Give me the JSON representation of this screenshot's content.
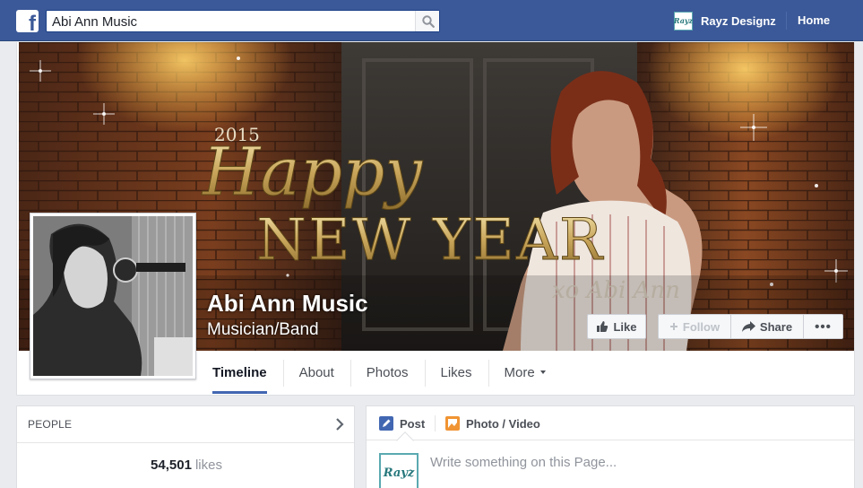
{
  "topbar": {
    "logo_letter": "f",
    "search_value": "Abi Ann Music",
    "profile_avatar_text": "Rayz",
    "profile_name": "Rayz Designz",
    "home_label": "Home"
  },
  "cover": {
    "year_text": "2015",
    "happy_text": "Happy",
    "new_year_text": "NEW YEAR",
    "signature_text": "xo Abi Ann"
  },
  "page": {
    "name": "Abi Ann Music",
    "category": "Musician/Band"
  },
  "actions": {
    "like_label": "Like",
    "follow_label": "Follow",
    "share_label": "Share",
    "more_label": "•••"
  },
  "tabs": [
    {
      "label": "Timeline",
      "active": true
    },
    {
      "label": "About"
    },
    {
      "label": "Photos"
    },
    {
      "label": "Likes"
    },
    {
      "label": "More"
    }
  ],
  "people": {
    "title": "PEOPLE",
    "likes_count": "54,501",
    "likes_label": "likes"
  },
  "composer": {
    "post_label": "Post",
    "photo_label": "Photo / Video",
    "avatar_text": "Rayz",
    "placeholder": "Write something on this Page..."
  },
  "colors": {
    "brand_blue": "#3b5998",
    "active_tab_underline": "#4267b2",
    "gold_text": "#d7bf76"
  }
}
